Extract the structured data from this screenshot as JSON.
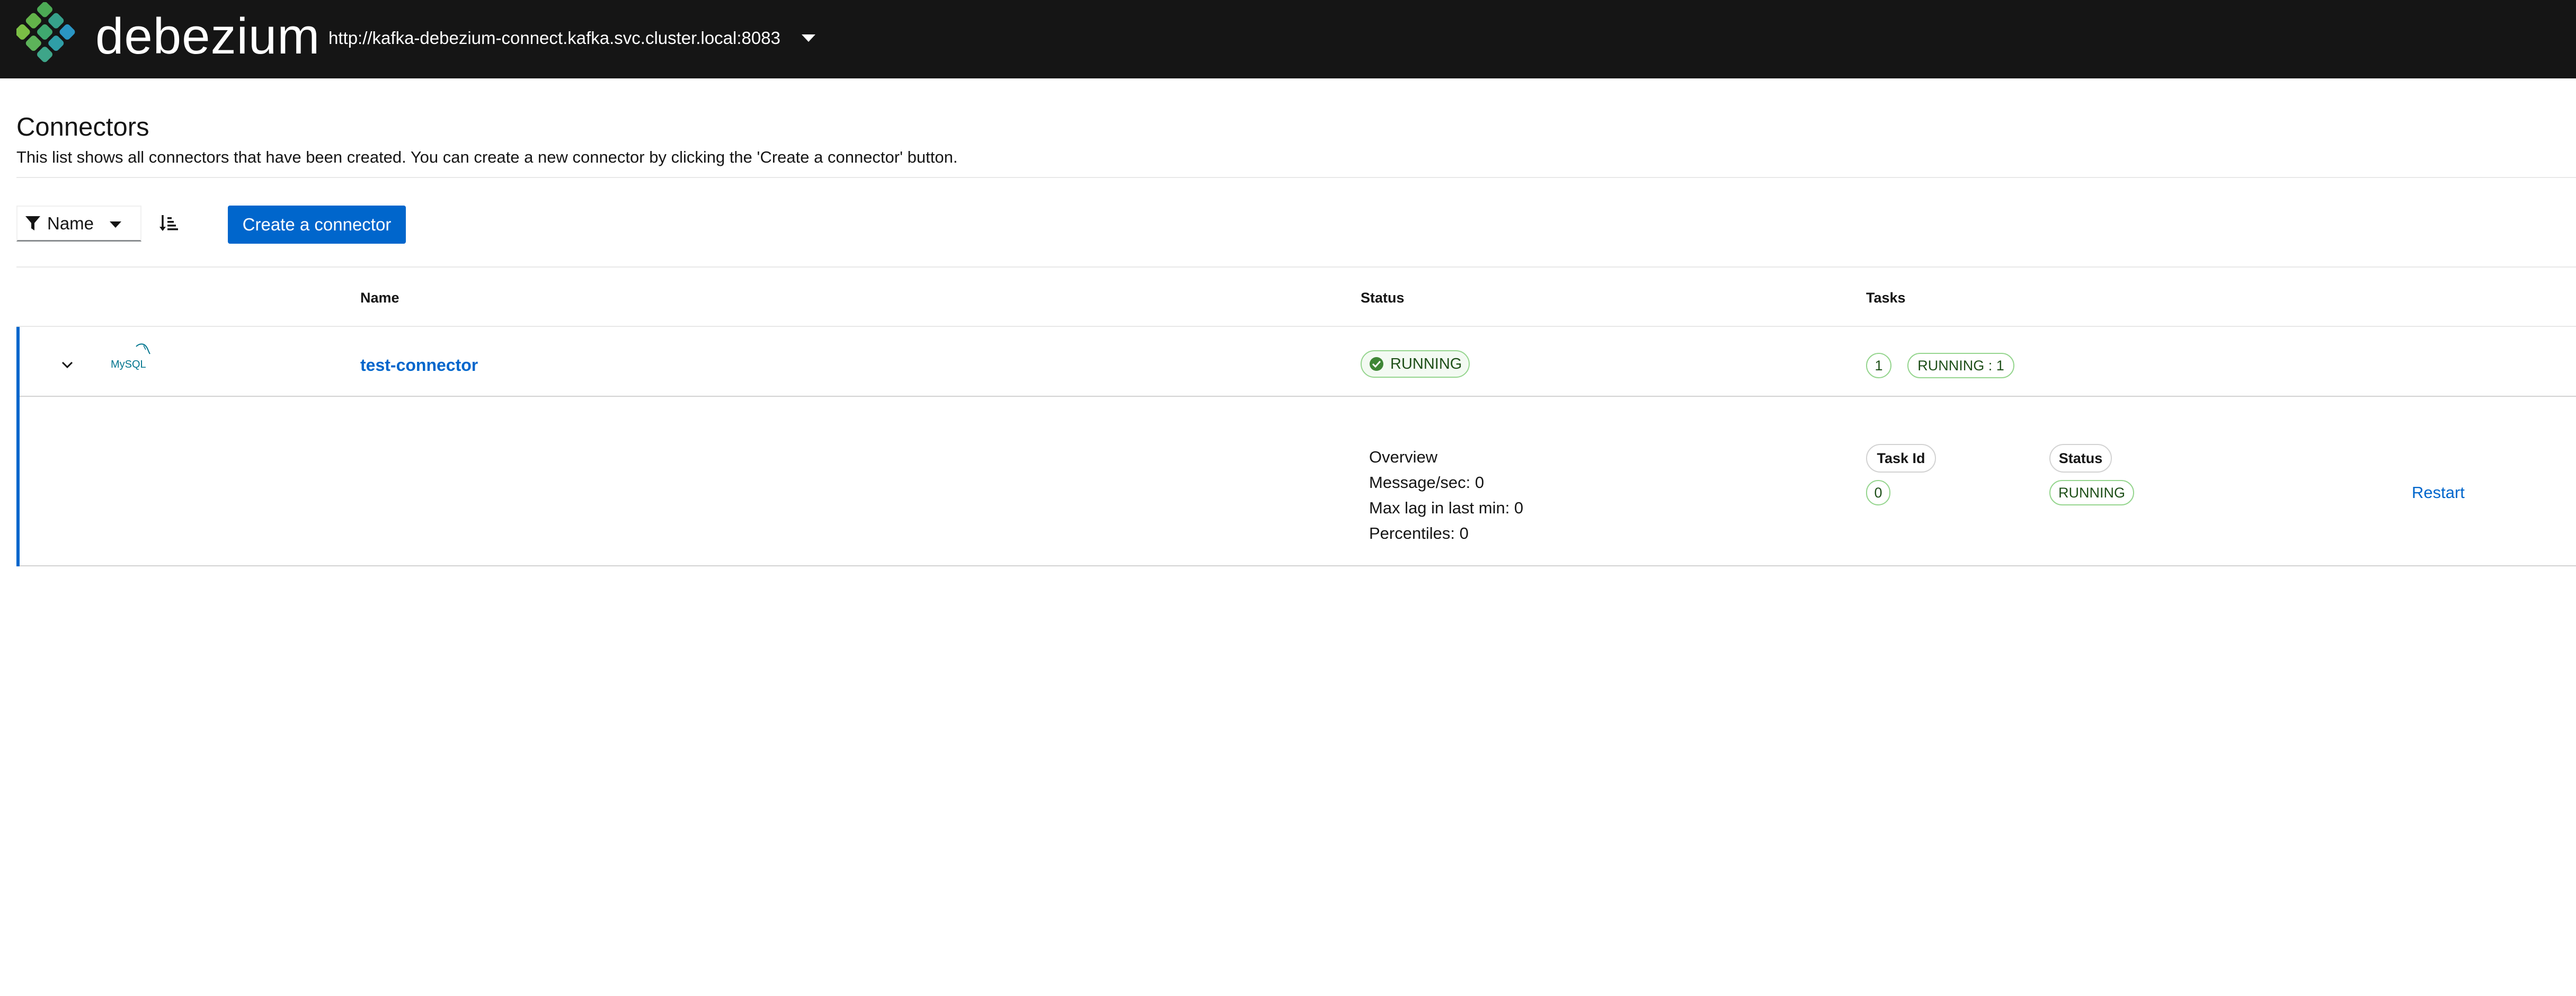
{
  "header": {
    "logo_text": "debezium",
    "cluster_url": "http://kafka-debezium-connect.kafka.svc.cluster.local:8083"
  },
  "page": {
    "title": "Connectors",
    "description": "This list shows all connectors that have been created. You can create a new connector by clicking the 'Create a connector' button."
  },
  "toolbar": {
    "filter_label": "Name",
    "create_button_label": "Create a connector"
  },
  "table": {
    "columns": [
      "Name",
      "Status",
      "Tasks"
    ],
    "rows": [
      {
        "connector_type_logo": "MySQL",
        "name": "test-connector",
        "status": "RUNNING",
        "task_count": "1",
        "task_summary": "RUNNING : 1",
        "details": {
          "overview_lines": [
            "Overview",
            "Message/sec: 0",
            "Max lag in last min: 0",
            "Percentiles: 0"
          ],
          "task_columns": [
            "Task Id",
            "Status"
          ],
          "tasks": [
            {
              "id": "0",
              "status": "RUNNING",
              "action": "Restart"
            }
          ]
        }
      }
    ]
  },
  "colors": {
    "header_bg": "#151515",
    "accent": "#0066cc",
    "success_border": "#95d58e",
    "success_text": "#1e4f18"
  },
  "icons": [
    "debezium-logo-icon",
    "caret-down-icon",
    "filter-icon",
    "sort-amount-down-icon",
    "angle-down-icon",
    "mysql-logo-icon",
    "check-circle-icon"
  ]
}
